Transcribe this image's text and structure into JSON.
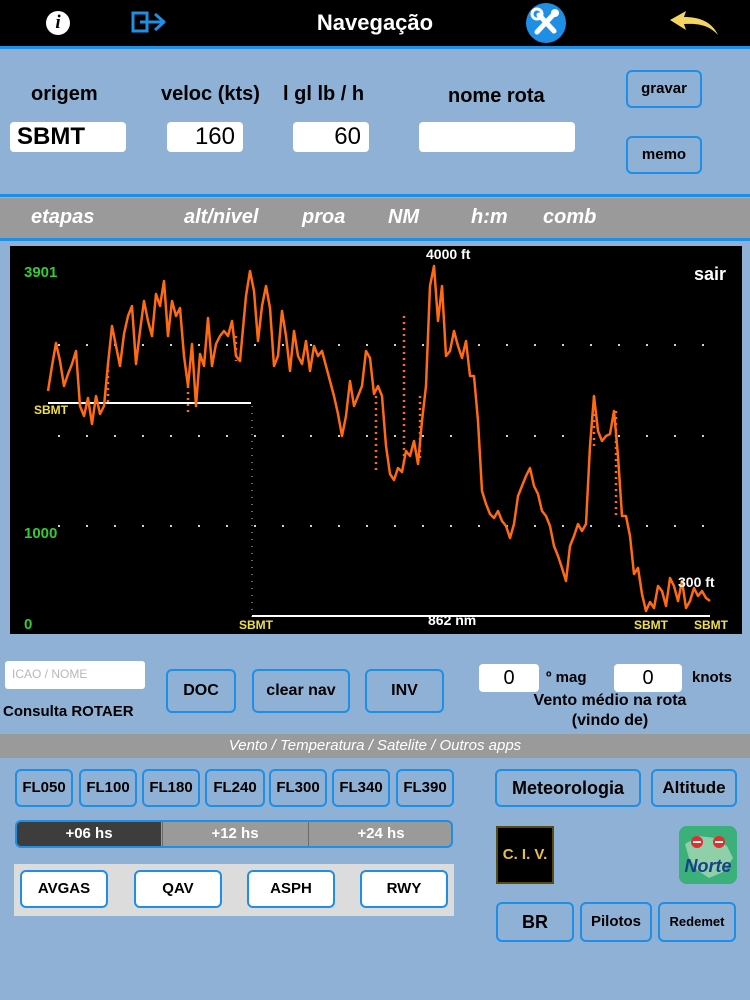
{
  "topbar": {
    "title": "Navegação",
    "info_icon": "info-icon",
    "exit_icon": "exit-arrow-icon",
    "tools_icon": "tools-icon",
    "back_icon": "back-arrow-icon"
  },
  "route": {
    "origem_label": "origem",
    "veloc_label": "veloc (kts)",
    "consumo_label": "l gl lb / h",
    "nome_rota_label": "nome rota",
    "origem_value": "SBMT",
    "veloc_value": "160",
    "consumo_value": "60",
    "nome_rota_value": "",
    "gravar_label": "gravar",
    "memo_label": "memo"
  },
  "etapas": {
    "etapas": "etapas",
    "alt_nivel": "alt/nivel",
    "proa": "proa",
    "nm": "NM",
    "hm": "h:m",
    "comb": "comb"
  },
  "profile": {
    "top_label": "3901",
    "mid_label": "1000",
    "zero_label": "0",
    "max_alt_label": "4000 ft",
    "end_alt_label": "300 ft",
    "distance_label": "862 nm",
    "sair_label": "sair",
    "start_left_label": "SBMT",
    "start_label": "SBMT",
    "end_label_1": "SBMT",
    "end_label_2": "SBMT",
    "line_color": "#ff6a13",
    "scale_color": "#33cc33",
    "airport_color": "#f0e040"
  },
  "rotaer": {
    "search_placeholder": "ICAO / NOME",
    "consulta_label": "Consulta ROTAER",
    "doc_label": "DOC",
    "clear_label": "clear nav",
    "inv_label": "INV"
  },
  "wind": {
    "direction_value": "0",
    "direction_unit": "º mag",
    "speed_value": "0",
    "speed_unit": "knots",
    "caption_1": "Vento médio na rota",
    "caption_2": "(vindo de)"
  },
  "weather": {
    "strip_text": "Vento / Temperatura / Satelite / Outros apps",
    "flight_levels": [
      "FL050",
      "FL100",
      "FL180",
      "FL240",
      "FL300",
      "FL340",
      "FL390"
    ],
    "hours": [
      "+06 hs",
      "+12 hs",
      "+24 hs"
    ],
    "selected_hour": "+06 hs",
    "fuel_buttons": [
      "AVGAS",
      "QAV",
      "ASPH",
      "RWY"
    ],
    "meteorologia_label": "Meteorologia",
    "altitude_label": "Altitude",
    "civ_label": "C. I. V.",
    "norte_label": "Norte",
    "br_label": "BR",
    "pilotos_label": "Pilotos",
    "redemet_label": "Redemet"
  }
}
